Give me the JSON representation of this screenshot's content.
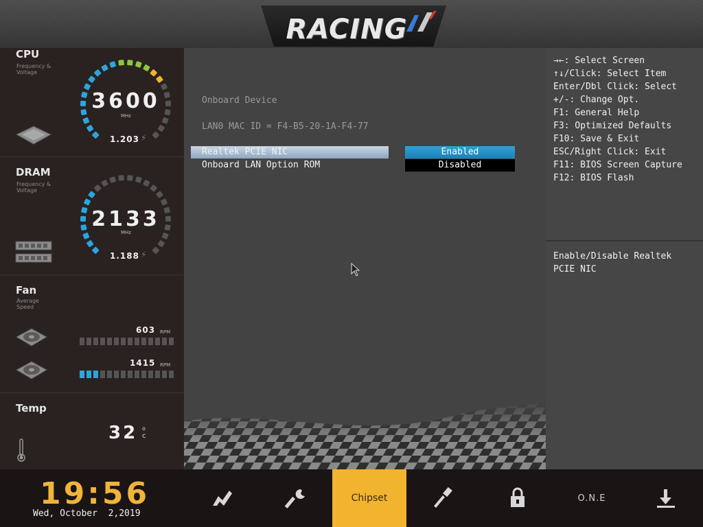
{
  "header": {
    "logo_text": "RACING"
  },
  "cpu": {
    "title": "CPU",
    "subtitle_1": "Frequency &",
    "subtitle_2": "Voltage",
    "freq": "3600",
    "unit": "MHz",
    "voltage": "1.203"
  },
  "dram": {
    "title": "DRAM",
    "subtitle_1": "Frequency &",
    "subtitle_2": "Voltage",
    "freq": "2133",
    "unit": "MHz",
    "voltage": "1.188"
  },
  "fan": {
    "title": "Fan",
    "subtitle_1": "Average",
    "subtitle_2": "Speed",
    "fans": [
      {
        "rpm": "603",
        "unit": "RPM"
      },
      {
        "rpm": "1415",
        "unit": "RPM"
      }
    ]
  },
  "temp": {
    "title": "Temp",
    "value": "32",
    "unit": "c"
  },
  "main": {
    "section_title": "Onboard Device",
    "mac_line": "LAN0 MAC ID = F4-B5-20-1A-F4-77",
    "items": [
      {
        "label": "Realtek PCIE NIC",
        "value": "Enabled"
      },
      {
        "label": "Onboard LAN Option ROM",
        "value": "Disabled"
      }
    ]
  },
  "help": {
    "lines": [
      "→←: Select Screen",
      "↑↓/Click: Select Item",
      "Enter/Dbl Click: Select",
      "+/-: Change Opt.",
      "F1: General Help",
      "F3: Optimized Defaults",
      "F10: Save & Exit",
      "ESC/Right Click: Exit",
      "F11: BIOS Screen Capture",
      "F12: BIOS Flash"
    ],
    "description_1": "Enable/Disable Realtek",
    "description_2": "PCIE NIC"
  },
  "footer": {
    "time": "19:56",
    "date": "Wed, October  2,2019",
    "tabs": [
      {
        "icon": "performance-icon"
      },
      {
        "icon": "wrench-icon"
      },
      {
        "label": "Chipset"
      },
      {
        "icon": "tool-icon"
      },
      {
        "icon": "lock-icon"
      },
      {
        "label": "O.N.E"
      },
      {
        "icon": "download-icon"
      }
    ]
  },
  "colors": {
    "accent": "#f2b32f",
    "enabled": "#2fa2d8",
    "gauge_blue": "#2aa6de",
    "gauge_green": "#8cc63f",
    "gauge_yellow": "#f2b32f"
  }
}
